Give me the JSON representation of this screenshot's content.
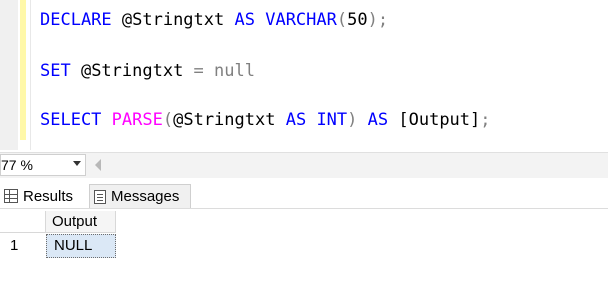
{
  "editor": {
    "lines": [
      {
        "id": "line-declare",
        "tokens": [
          {
            "text": "DECLARE",
            "cls": "kw"
          },
          {
            "text": " @Stringtxt ",
            "cls": ""
          },
          {
            "text": "AS",
            "cls": "kw"
          },
          {
            "text": " ",
            "cls": ""
          },
          {
            "text": "VARCHAR",
            "cls": "kw"
          },
          {
            "text": "(",
            "cls": "op"
          },
          {
            "text": "50",
            "cls": "num"
          },
          {
            "text": ");",
            "cls": "op"
          }
        ]
      },
      {
        "id": "line-set",
        "tokens": [
          {
            "text": "SET",
            "cls": "kw"
          },
          {
            "text": " @Stringtxt ",
            "cls": ""
          },
          {
            "text": "=",
            "cls": "op"
          },
          {
            "text": " ",
            "cls": ""
          },
          {
            "text": "null",
            "cls": "nul"
          }
        ]
      },
      {
        "id": "line-select",
        "tokens": [
          {
            "text": "SELECT",
            "cls": "kw"
          },
          {
            "text": " ",
            "cls": ""
          },
          {
            "text": "PARSE",
            "cls": "fn"
          },
          {
            "text": "(",
            "cls": "op"
          },
          {
            "text": "@Stringtxt ",
            "cls": ""
          },
          {
            "text": "AS",
            "cls": "kw"
          },
          {
            "text": " ",
            "cls": ""
          },
          {
            "text": "INT",
            "cls": "kw"
          },
          {
            "text": ")",
            "cls": "op"
          },
          {
            "text": " ",
            "cls": ""
          },
          {
            "text": "AS",
            "cls": "kw"
          },
          {
            "text": " [Output]",
            "cls": ""
          },
          {
            "text": ";",
            "cls": "op"
          }
        ]
      }
    ]
  },
  "zoom": {
    "value": "77 %"
  },
  "tabs": {
    "results": "Results",
    "messages": "Messages"
  },
  "grid": {
    "columns": [
      "Output"
    ],
    "rows": [
      {
        "num": "1",
        "cells": [
          "NULL"
        ]
      }
    ]
  },
  "colors": {
    "keyword": "#0000ff",
    "function": "#ff00ff",
    "null": "#808080",
    "selected_cell": "#dbe8f6"
  }
}
